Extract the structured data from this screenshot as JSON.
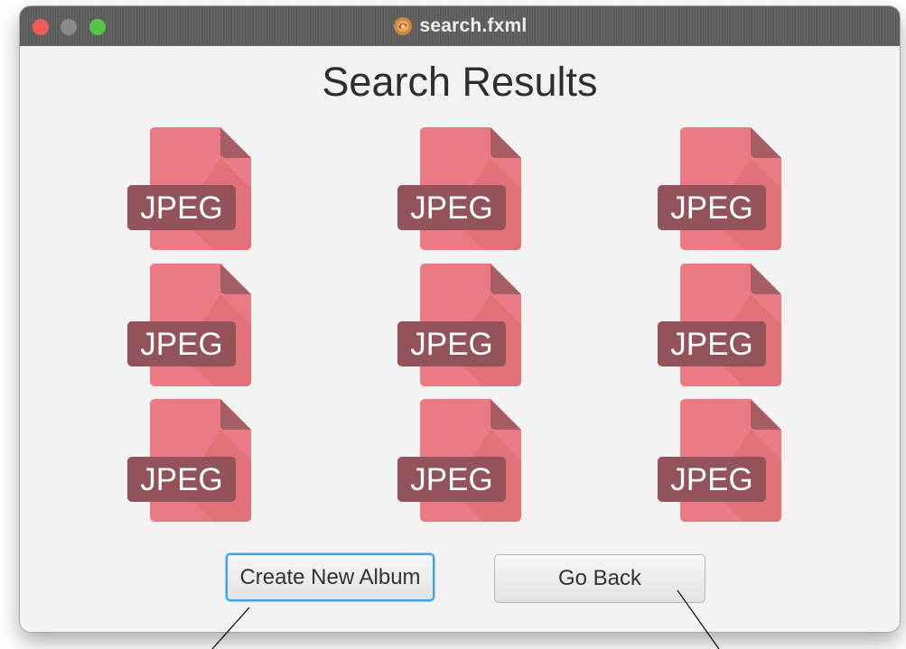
{
  "window": {
    "title": "search.fxml"
  },
  "heading": "Search Results",
  "results": [
    {
      "label": "JPEG"
    },
    {
      "label": "JPEG"
    },
    {
      "label": "JPEG"
    },
    {
      "label": "JPEG"
    },
    {
      "label": "JPEG"
    },
    {
      "label": "JPEG"
    },
    {
      "label": "JPEG"
    },
    {
      "label": "JPEG"
    },
    {
      "label": "JPEG"
    }
  ],
  "buttons": {
    "create": "Create New Album",
    "back": "Go Back"
  },
  "colors": {
    "file_body": "#eb7a84",
    "file_fold": "#a55e63",
    "file_shadow": "#d9676f",
    "label_bg": "#93535a",
    "label_text": "#ffffff",
    "focus_ring": "#3ea2e6"
  }
}
